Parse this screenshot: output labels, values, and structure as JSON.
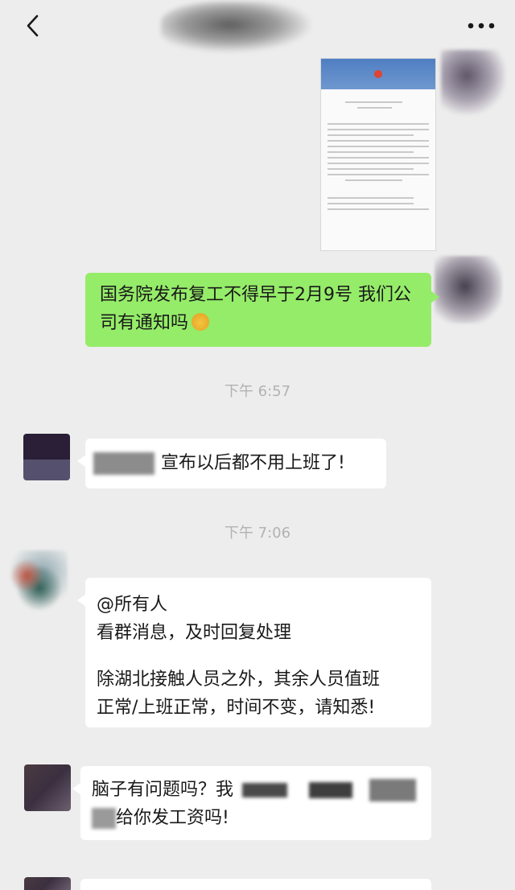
{
  "header": {
    "back_icon": "chevron-left-icon",
    "more_icon": "more-dots-icon"
  },
  "messages": {
    "m1_text": "国务院发布复工不得早于2月9号 我们公司有通知吗",
    "m1_emoji": "emoji-icon",
    "time1": "下午 6:57",
    "m2_text": "宣布以后都不用上班了!",
    "time2": "下午 7:06",
    "m3_line1": "@所有人",
    "m3_line2": "看群消息，及时回复处理",
    "m3_line3": "除湖北接触人员之外，其余人员值班",
    "m3_line4": "正常/上班正常，时间不变，请知悉!",
    "m4_line1": "脑子有问题吗？我",
    "m4_line2": "给你发工资吗!"
  },
  "colors": {
    "background": "#ededed",
    "self_bubble": "#95ec69",
    "other_bubble": "#ffffff",
    "timestamp": "#b2b2b2"
  }
}
